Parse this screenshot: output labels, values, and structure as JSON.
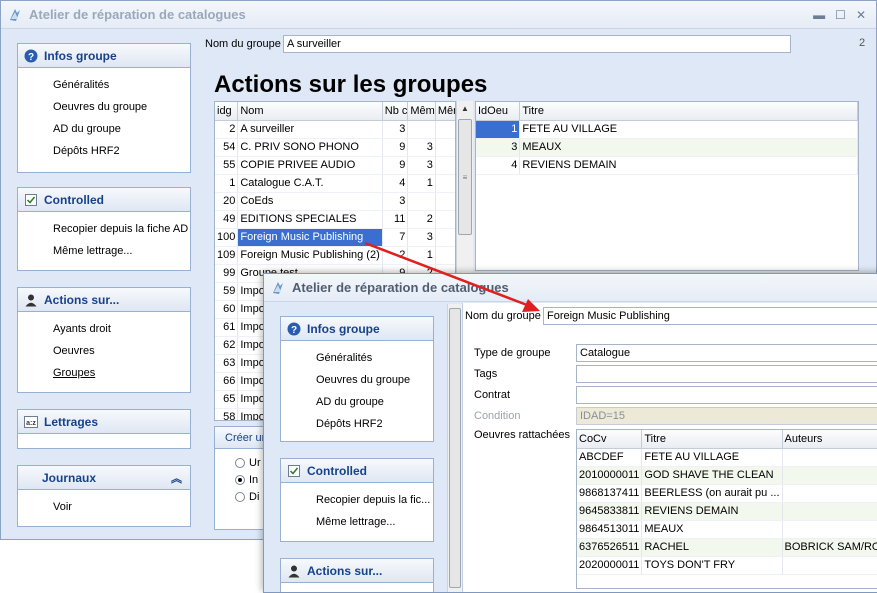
{
  "back": {
    "title": "Atelier de réparation de catalogues",
    "page_number": "2",
    "group_name_label": "Nom du groupe",
    "group_name_value": "A surveiller",
    "heading": "Actions sur les groupes",
    "panels": {
      "infos": {
        "title": "Infos groupe",
        "items": [
          "Généralités",
          "Oeuvres du groupe",
          "AD du groupe",
          "Dépôts HRF2"
        ]
      },
      "controlled": {
        "title": "Controlled",
        "items": [
          "Recopier depuis la fiche AD",
          "Même lettrage..."
        ]
      },
      "actions": {
        "title": "Actions sur...",
        "items": [
          "Ayants droit",
          "Oeuvres",
          "Groupes"
        ]
      },
      "lettrages": {
        "title": "Lettrages"
      },
      "journaux": {
        "title": "Journaux",
        "items": [
          "Voir"
        ]
      }
    },
    "groups_table": {
      "columns": [
        "idg",
        "Nom",
        "Nb c",
        "Mêm",
        "Mêm"
      ],
      "rows": [
        [
          "2",
          "A surveiller",
          "3",
          ""
        ],
        [
          "54",
          "C. PRIV SONO PHONO",
          "9",
          "3"
        ],
        [
          "55",
          "COPIE PRIVEE AUDIO",
          "9",
          "3"
        ],
        [
          "1",
          "Catalogue C.A.T.",
          "4",
          "1"
        ],
        [
          "20",
          "CoEds",
          "3",
          ""
        ],
        [
          "49",
          "EDITIONS SPECIALES",
          "11",
          "2"
        ],
        [
          "100",
          "Foreign Music Publishing",
          "7",
          "3"
        ],
        [
          "109",
          "Foreign Music Publishing (2)",
          "2",
          "1"
        ],
        [
          "99",
          "Groupe test",
          "9",
          "2"
        ],
        [
          "59",
          "Impor",
          "",
          ""
        ],
        [
          "60",
          "Impor",
          "",
          ""
        ],
        [
          "61",
          "Impor",
          "",
          ""
        ],
        [
          "62",
          "Impor",
          "",
          ""
        ],
        [
          "63",
          "Impor",
          "",
          ""
        ],
        [
          "66",
          "Impor",
          "",
          ""
        ],
        [
          "65",
          "Impor",
          "",
          ""
        ],
        [
          "58",
          "Impor",
          "",
          ""
        ]
      ]
    },
    "works_table": {
      "columns": [
        "IdOeu",
        "Titre"
      ],
      "rows": [
        [
          "1",
          "FETE AU VILLAGE"
        ],
        [
          "3",
          "MEAUX"
        ],
        [
          "4",
          "REVIENS DEMAIN"
        ]
      ]
    },
    "create_group": {
      "label": "Créer un",
      "options": [
        "Ur",
        "In",
        "Di"
      ]
    }
  },
  "front": {
    "title": "Atelier de réparation de catalogues",
    "group_name_label": "Nom du groupe",
    "group_name_value": "Foreign Music Publishing",
    "panels": {
      "infos": {
        "title": "Infos groupe",
        "items": [
          "Généralités",
          "Oeuvres du groupe",
          "AD du groupe",
          "Dépôts HRF2"
        ]
      },
      "controlled": {
        "title": "Controlled",
        "items": [
          "Recopier depuis la fic...",
          "Même lettrage..."
        ]
      },
      "actions": {
        "title": "Actions sur..."
      }
    },
    "form": {
      "type_label": "Type de groupe",
      "type_value": "Catalogue",
      "tags_label": "Tags",
      "tags_value": "",
      "contrat_label": "Contrat",
      "contrat_value": "",
      "condition_label": "Condition",
      "condition_value": "IDAD=15",
      "oeuvres_label": "Oeuvres rattachées"
    },
    "works_table": {
      "columns": [
        "CoCv",
        "Titre",
        "Auteurs"
      ],
      "rows": [
        [
          "ABCDEF",
          "FETE AU VILLAGE",
          ""
        ],
        [
          "2010000011",
          "GOD SHAVE THE CLEAN",
          ""
        ],
        [
          "9868137411",
          "BEERLESS (on aurait pu ...",
          ""
        ],
        [
          "9645833811",
          "REVIENS DEMAIN",
          ""
        ],
        [
          "9864513011",
          "MEAUX",
          ""
        ],
        [
          "6376526511",
          "RACHEL",
          "BOBRICK SAM/ROSS"
        ],
        [
          "2020000011",
          "TOYS DON'T FRY",
          ""
        ]
      ]
    }
  },
  "colors": {
    "selection": "#3a6fd0",
    "panel_header_text": "#15428b",
    "arrow": "#e02020"
  }
}
